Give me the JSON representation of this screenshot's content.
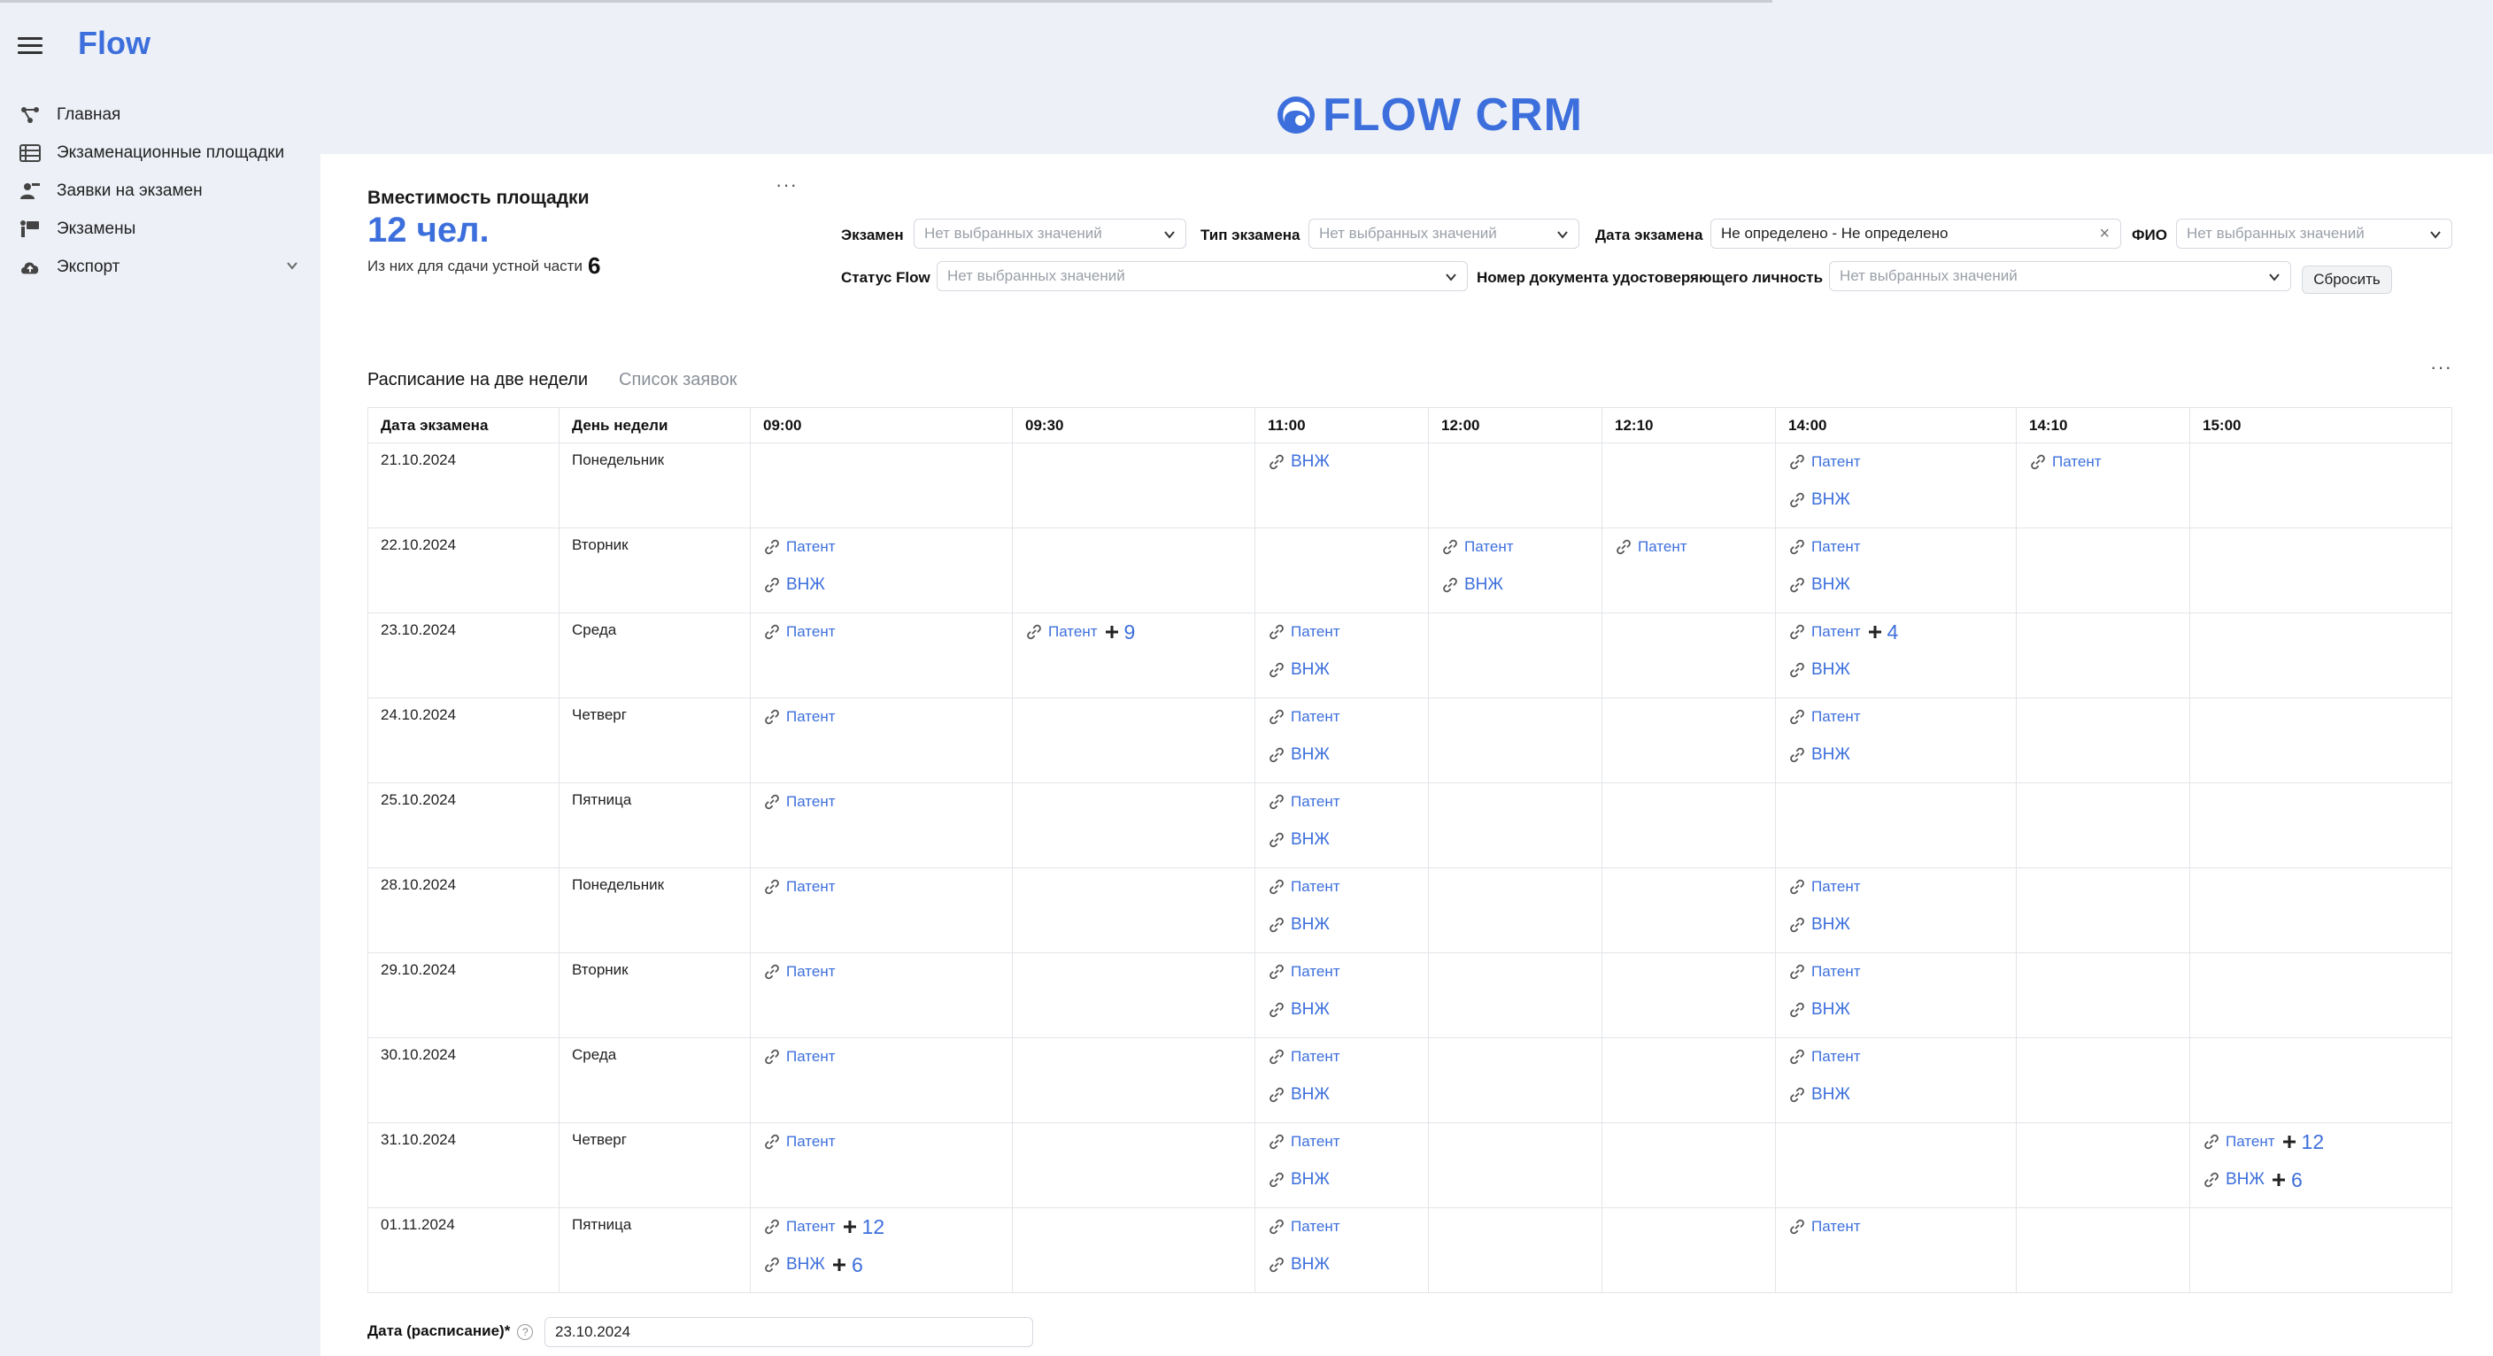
{
  "app": {
    "brand": "Flow",
    "logo_text": "FLOW CRM"
  },
  "sidebar": {
    "items": [
      {
        "label": "Главная",
        "icon": "home-icon"
      },
      {
        "label": "Экзаменационные площадки",
        "icon": "list-icon"
      },
      {
        "label": "Заявки на экзамен",
        "icon": "applications-icon"
      },
      {
        "label": "Экзамены",
        "icon": "exams-icon"
      },
      {
        "label": "Экспорт",
        "icon": "cloud-upload-icon",
        "expandable": true
      }
    ]
  },
  "capacity": {
    "title": "Вместимость площадки",
    "value": "12 чел.",
    "sub_label": "Из них для сдачи устной части",
    "sub_value": "6"
  },
  "filters": {
    "exam": {
      "label": "Экзамен",
      "placeholder": "Нет выбранных значений"
    },
    "exam_type": {
      "label": "Тип экзамена",
      "placeholder": "Нет выбранных значений"
    },
    "exam_date": {
      "label": "Дата экзамена",
      "value": "Не определено - Не определено"
    },
    "fio": {
      "label": "ФИО",
      "placeholder": "Нет выбранных значений"
    },
    "flow_status": {
      "label": "Статус Flow",
      "placeholder": "Нет выбранных значений"
    },
    "id_doc": {
      "label": "Номер документа удостоверяющего личность",
      "placeholder": "Нет выбранных значений"
    },
    "reset_label": "Сбросить"
  },
  "schedule": {
    "tabs": [
      {
        "label": "Расписание на две недели",
        "active": true
      },
      {
        "label": "Список заявок",
        "active": false
      }
    ],
    "columns": [
      "Дата экзамена",
      "День недели",
      "09:00",
      "09:30",
      "11:00",
      "12:00",
      "12:10",
      "14:00",
      "14:10",
      "15:00"
    ],
    "rows": [
      {
        "date": "21.10.2024",
        "day": "Понедельник",
        "slots": [
          [],
          [],
          [
            {
              "t": "ВНЖ"
            }
          ],
          [],
          [],
          [
            {
              "t": "Патент"
            },
            {
              "t": "ВНЖ"
            }
          ],
          [
            {
              "t": "Патент"
            }
          ],
          []
        ]
      },
      {
        "date": "22.10.2024",
        "day": "Вторник",
        "slots": [
          [
            {
              "t": "Патент"
            },
            {
              "t": "ВНЖ"
            }
          ],
          [],
          [],
          [
            {
              "t": "Патент"
            },
            {
              "t": "ВНЖ"
            }
          ],
          [
            {
              "t": "Патент"
            }
          ],
          [
            {
              "t": "Патент"
            },
            {
              "t": "ВНЖ"
            }
          ],
          [],
          []
        ]
      },
      {
        "date": "23.10.2024",
        "day": "Среда",
        "slots": [
          [
            {
              "t": "Патент"
            }
          ],
          [
            {
              "t": "Патент",
              "plus": "9"
            }
          ],
          [
            {
              "t": "Патент"
            },
            {
              "t": "ВНЖ"
            }
          ],
          [],
          [],
          [
            {
              "t": "Патент",
              "plus": "4"
            },
            {
              "t": "ВНЖ"
            }
          ],
          [],
          []
        ]
      },
      {
        "date": "24.10.2024",
        "day": "Четверг",
        "slots": [
          [
            {
              "t": "Патент"
            }
          ],
          [],
          [
            {
              "t": "Патент"
            },
            {
              "t": "ВНЖ"
            }
          ],
          [],
          [],
          [
            {
              "t": "Патент"
            },
            {
              "t": "ВНЖ"
            }
          ],
          [],
          []
        ]
      },
      {
        "date": "25.10.2024",
        "day": "Пятница",
        "slots": [
          [
            {
              "t": "Патент"
            }
          ],
          [],
          [
            {
              "t": "Патент"
            },
            {
              "t": "ВНЖ"
            }
          ],
          [],
          [],
          [],
          [],
          []
        ]
      },
      {
        "date": "28.10.2024",
        "day": "Понедельник",
        "slots": [
          [
            {
              "t": "Патент"
            }
          ],
          [],
          [
            {
              "t": "Патент"
            },
            {
              "t": "ВНЖ"
            }
          ],
          [],
          [],
          [
            {
              "t": "Патент"
            },
            {
              "t": "ВНЖ"
            }
          ],
          [],
          []
        ]
      },
      {
        "date": "29.10.2024",
        "day": "Вторник",
        "slots": [
          [
            {
              "t": "Патент"
            }
          ],
          [],
          [
            {
              "t": "Патент"
            },
            {
              "t": "ВНЖ"
            }
          ],
          [],
          [],
          [
            {
              "t": "Патент"
            },
            {
              "t": "ВНЖ"
            }
          ],
          [],
          []
        ]
      },
      {
        "date": "30.10.2024",
        "day": "Среда",
        "slots": [
          [
            {
              "t": "Патент"
            }
          ],
          [],
          [
            {
              "t": "Патент"
            },
            {
              "t": "ВНЖ"
            }
          ],
          [],
          [],
          [
            {
              "t": "Патент"
            },
            {
              "t": "ВНЖ"
            }
          ],
          [],
          []
        ]
      },
      {
        "date": "31.10.2024",
        "day": "Четверг",
        "slots": [
          [
            {
              "t": "Патент"
            }
          ],
          [],
          [
            {
              "t": "Патент"
            },
            {
              "t": "ВНЖ"
            }
          ],
          [],
          [],
          [],
          [],
          [
            {
              "t": "Патент",
              "plus": "12"
            },
            {
              "t": "ВНЖ",
              "plus": "6"
            }
          ]
        ]
      },
      {
        "date": "01.11.2024",
        "day": "Пятница",
        "slots": [
          [
            {
              "t": "Патент",
              "plus": "12"
            },
            {
              "t": "ВНЖ",
              "plus": "6"
            }
          ],
          [],
          [
            {
              "t": "Патент"
            },
            {
              "t": "ВНЖ"
            }
          ],
          [],
          [],
          [
            {
              "t": "Патент"
            }
          ],
          [],
          []
        ]
      }
    ]
  },
  "date_field": {
    "label": "Дата (расписание)*",
    "value": "23.10.2024"
  },
  "colors": {
    "accent": "#3d6fdc",
    "background": "#edf0f7",
    "text": "#1a1a1a"
  }
}
